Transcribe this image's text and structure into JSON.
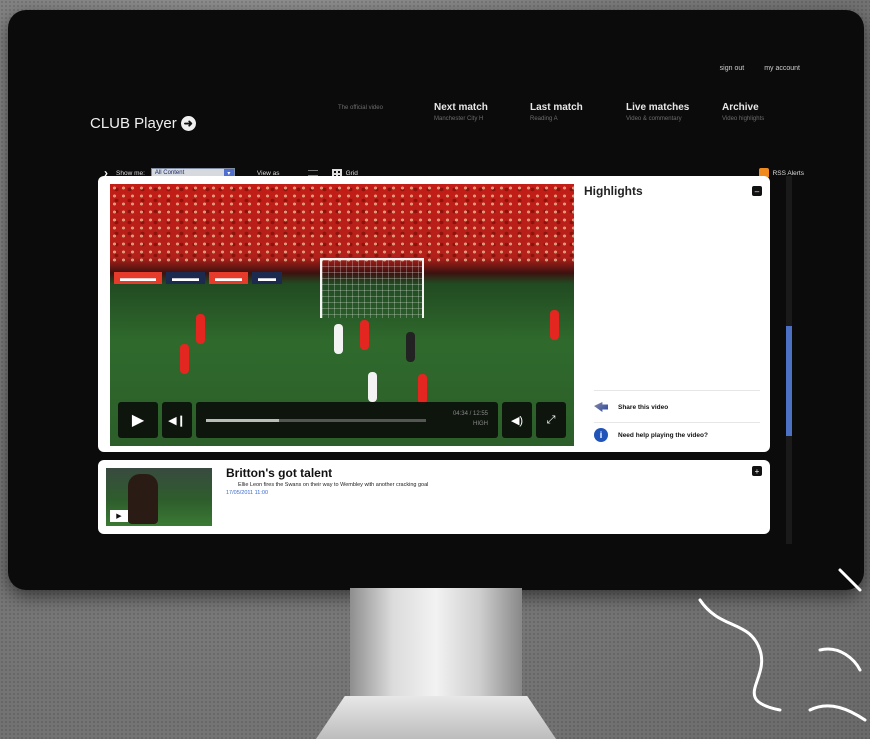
{
  "header": {
    "banner_text": "",
    "links": [
      "sign out",
      "my account"
    ],
    "logo_text": "CLUB Player"
  },
  "nav": {
    "items": [
      {
        "label": "",
        "sub": "The official video"
      },
      {
        "label": "Next match",
        "sub": "Manchester City H"
      },
      {
        "label": "Last match",
        "sub": "Reading A"
      },
      {
        "label": "Live matches",
        "sub": "Video & commentary"
      },
      {
        "label": "Archive",
        "sub": "Video highlights"
      }
    ]
  },
  "filter": {
    "show_label": "Show me:",
    "select_value": "All Content",
    "view_as_label": "View as",
    "grid_label": "Grid",
    "rss_label": "RSS Alerts"
  },
  "player": {
    "time_current": "04:34 / 12:55",
    "time_quality": "HIGH",
    "progress": 0.33
  },
  "side": {
    "title": "Highlights",
    "share_label": "Share this video",
    "help_label": "Need help playing the video?"
  },
  "item": {
    "title": "Britton's got talent",
    "description": "Ellie Leon fires the Swans on their way to Wembley with another cracking goal",
    "date": "17/05/2011 11:00"
  },
  "colors": {
    "brand_red": "#c21d16",
    "accent_blue": "#3a6ad0",
    "rss_orange": "#f08a1c"
  }
}
